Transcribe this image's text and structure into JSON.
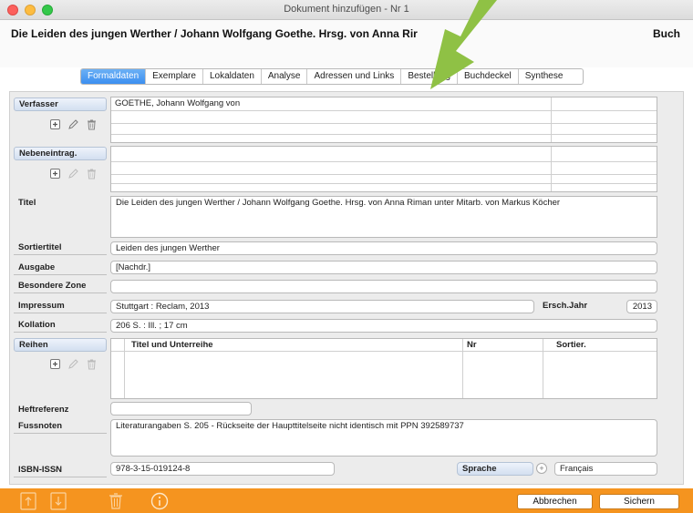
{
  "window": {
    "title": "Dokument hinzufügen - Nr 1"
  },
  "header": {
    "doc_title": "Die Leiden des jungen Werther / Johann Wolfgang Goethe. Hrsg. von Anna Rir",
    "doc_type": "Buch"
  },
  "tabs": [
    {
      "label": "Formaldaten",
      "active": true
    },
    {
      "label": "Exemplare"
    },
    {
      "label": "Lokaldaten"
    },
    {
      "label": "Analyse"
    },
    {
      "label": "Adressen und Links"
    },
    {
      "label": "Bestellung"
    },
    {
      "label": "Buchdeckel"
    },
    {
      "label": "Synthese"
    }
  ],
  "form": {
    "verfasser": {
      "label": "Verfasser",
      "value": "GOETHE, Johann Wolfgang von"
    },
    "nebeneintrag": {
      "label": "Nebeneintrag."
    },
    "titel": {
      "label": "Titel",
      "value": "Die Leiden des jungen Werther / Johann Wolfgang Goethe. Hrsg. von Anna Riman unter Mitarb. von Markus Köcher"
    },
    "sortiertitel": {
      "label": "Sortiertitel",
      "value": "Leiden des jungen Werther"
    },
    "ausgabe": {
      "label": "Ausgabe",
      "value": "[Nachdr.]"
    },
    "besondere_zone": {
      "label": "Besondere Zone",
      "value": ""
    },
    "impressum": {
      "label": "Impressum",
      "value": "Stuttgart : Reclam, 2013"
    },
    "ersch_jahr": {
      "label": "Ersch.Jahr",
      "value": "2013"
    },
    "kollation": {
      "label": "Kollation",
      "value": "206 S. : Ill. ; 17 cm"
    },
    "reihen": {
      "label": "Reihen",
      "col_titel": "Titel und Unterreihe",
      "col_nr": "Nr",
      "col_sortier": "Sortier."
    },
    "heftreferenz": {
      "label": "Heftreferenz",
      "value": ""
    },
    "fussnoten": {
      "label": "Fussnoten",
      "value": "Literaturangaben S. 205 - Rückseite der Haupttitelseite nicht identisch mit PPN 392589737"
    },
    "isbn": {
      "label": "ISBN-ISSN",
      "value": "978-3-15-019124-8"
    },
    "sprache": {
      "label": "Sprache",
      "value": "Français"
    }
  },
  "footer": {
    "cancel_label": "Abbrechen",
    "save_label": "Sichern"
  },
  "colors": {
    "footer_bg": "#f5941f",
    "tab_active": "#3b8ff0",
    "arrow": "#8fc145"
  }
}
